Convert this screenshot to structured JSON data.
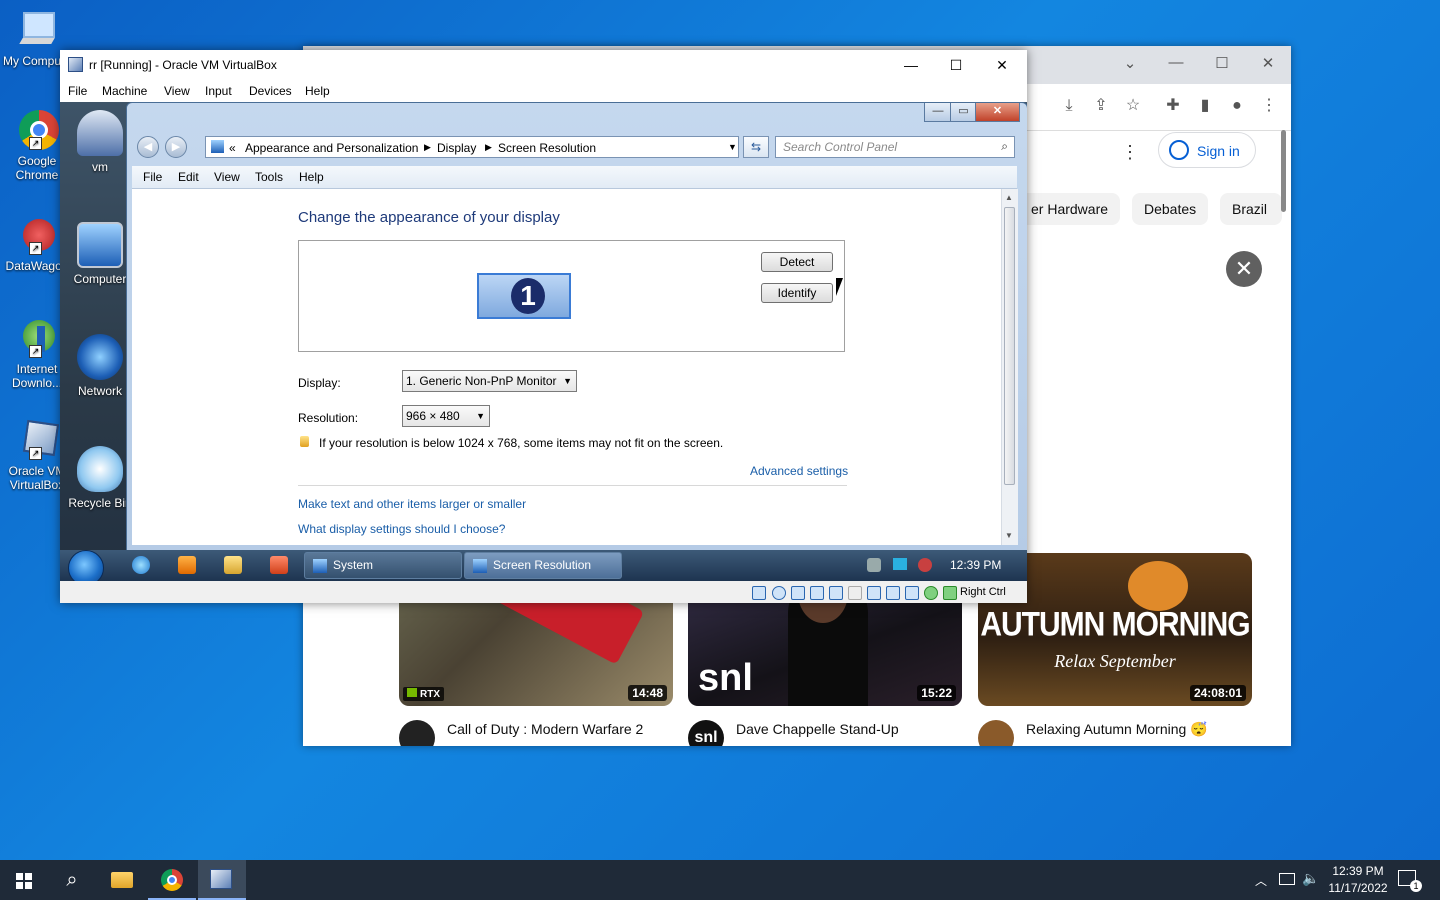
{
  "desktop": {
    "icons": [
      {
        "label": "My Compute",
        "icon": "computer-icon"
      },
      {
        "label": "Google Chrome",
        "icon": "chrome-icon"
      },
      {
        "label": "DataWagon",
        "icon": "datawagon-icon"
      },
      {
        "label": "Internet Downlo...",
        "icon": "download-manager-icon"
      },
      {
        "label": "Oracle VM VirtualBox",
        "icon": "virtualbox-icon"
      }
    ]
  },
  "chrome": {
    "signin_label": "Sign in",
    "chips": [
      "er Hardware",
      "Debates",
      "Brazil"
    ],
    "videos": [
      {
        "duration": "14:48",
        "title": "Call of Duty : Modern Warfare 2",
        "badge": "RTX"
      },
      {
        "duration": "15:22",
        "title": "Dave Chappelle Stand-Up",
        "badge": "snl",
        "avatar_text": "snl"
      },
      {
        "duration": "24:08:01",
        "title": "Relaxing Autumn Morning 😴",
        "thumb_title": "AUTUMN MORNING",
        "thumb_sub": "Relax September"
      }
    ]
  },
  "vbox": {
    "title": "rr [Running] - Oracle VM VirtualBox",
    "menu": [
      "File",
      "Machine",
      "View",
      "Input",
      "Devices",
      "Help"
    ],
    "host_key": "Right Ctrl"
  },
  "guest": {
    "icons": [
      "vm",
      "Computer",
      "Network",
      "Recycle Bin"
    ],
    "window": {
      "breadcrumb_prefix": "«",
      "breadcrumb": [
        "Appearance and Personalization",
        "Display",
        "Screen Resolution"
      ],
      "search_placeholder": "Search Control Panel",
      "menu": [
        "File",
        "Edit",
        "View",
        "Tools",
        "Help"
      ],
      "heading": "Change the appearance of your display",
      "monitor_number": "1",
      "detect_label": "Detect",
      "identify_label": "Identify",
      "display_label": "Display:",
      "display_value": "1. Generic Non-PnP Monitor",
      "resolution_label": "Resolution:",
      "resolution_value": "966 × 480",
      "warning": "If your resolution is below 1024 x 768, some items may not fit on the screen.",
      "advanced_link": "Advanced settings",
      "link1": "Make text and other items larger or smaller",
      "link2": "What display settings should I choose?"
    },
    "taskbar": {
      "tasks": [
        "System",
        "Screen Resolution"
      ],
      "clock": "12:39 PM"
    }
  },
  "taskbar": {
    "time": "12:39 PM",
    "date": "11/17/2022",
    "notification_count": "1"
  }
}
